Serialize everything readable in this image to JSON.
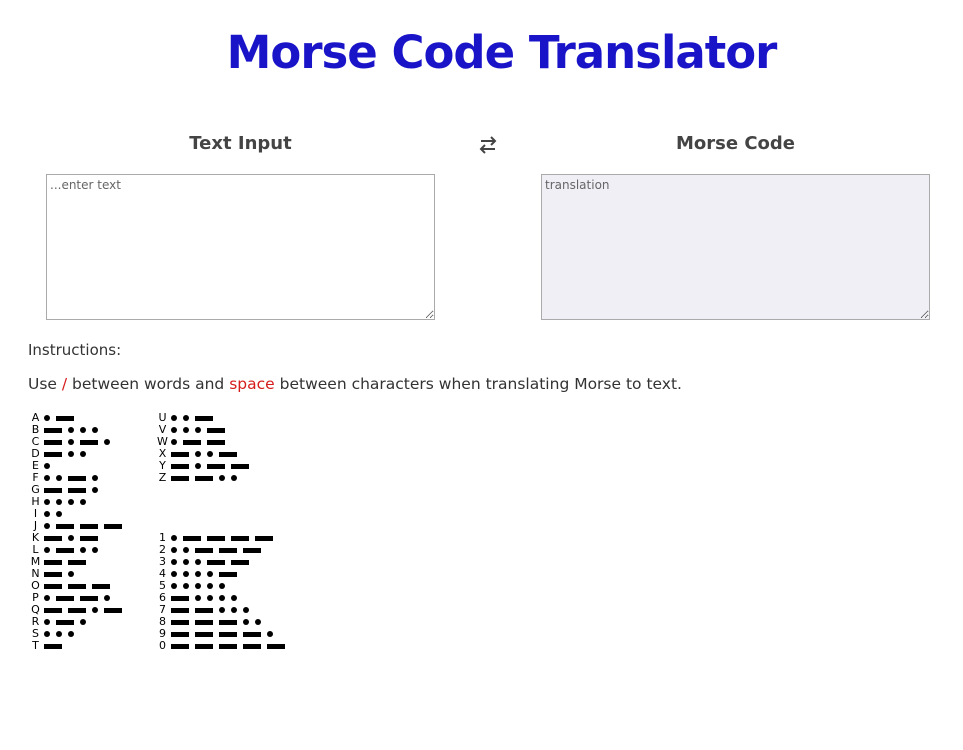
{
  "page": {
    "title": "Morse Code Translator"
  },
  "input": {
    "heading": "Text Input",
    "placeholder": "...enter text",
    "value": ""
  },
  "output": {
    "heading": "Morse Code",
    "placeholder": "translation",
    "value": ""
  },
  "swap": {
    "icon": "swap-arrows-icon"
  },
  "instructions": {
    "label": "Instructions:",
    "parts": {
      "p1": "Use ",
      "slash": "/",
      "p2": " between words and ",
      "space": "space",
      "p3": " between characters when translating Morse to text."
    }
  },
  "colors": {
    "title": "#1a14c9",
    "highlight": "#d61c1c",
    "output_bg": "#f1eff6"
  },
  "morse_chart": {
    "left": [
      {
        "char": "A",
        "code": ".-"
      },
      {
        "char": "B",
        "code": "-..."
      },
      {
        "char": "C",
        "code": "-.-."
      },
      {
        "char": "D",
        "code": "-.."
      },
      {
        "char": "E",
        "code": "."
      },
      {
        "char": "F",
        "code": "..-."
      },
      {
        "char": "G",
        "code": "--."
      },
      {
        "char": "H",
        "code": "...."
      },
      {
        "char": "I",
        "code": ".."
      },
      {
        "char": "J",
        "code": ".---"
      },
      {
        "char": "K",
        "code": "-.-"
      },
      {
        "char": "L",
        "code": ".-.."
      },
      {
        "char": "M",
        "code": "--"
      },
      {
        "char": "N",
        "code": "-."
      },
      {
        "char": "O",
        "code": "---"
      },
      {
        "char": "P",
        "code": ".--."
      },
      {
        "char": "Q",
        "code": "--.-"
      },
      {
        "char": "R",
        "code": ".-."
      },
      {
        "char": "S",
        "code": "..."
      },
      {
        "char": "T",
        "code": "-"
      }
    ],
    "right_letters": [
      {
        "char": "U",
        "code": "..-"
      },
      {
        "char": "V",
        "code": "...-"
      },
      {
        "char": "W",
        "code": ".--"
      },
      {
        "char": "X",
        "code": "-..-"
      },
      {
        "char": "Y",
        "code": "-.--"
      },
      {
        "char": "Z",
        "code": "--.."
      }
    ],
    "right_numbers": [
      {
        "char": "1",
        "code": ".----"
      },
      {
        "char": "2",
        "code": "..---"
      },
      {
        "char": "3",
        "code": "...--"
      },
      {
        "char": "4",
        "code": "....-"
      },
      {
        "char": "5",
        "code": "....."
      },
      {
        "char": "6",
        "code": "-...."
      },
      {
        "char": "7",
        "code": "--..."
      },
      {
        "char": "8",
        "code": "---.."
      },
      {
        "char": "9",
        "code": "----."
      },
      {
        "char": "0",
        "code": "-----"
      }
    ]
  }
}
